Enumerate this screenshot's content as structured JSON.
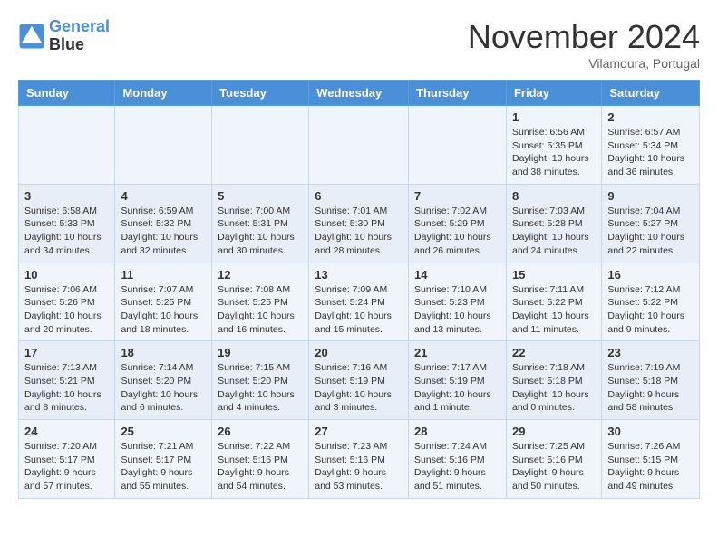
{
  "logo": {
    "line1": "General",
    "line2": "Blue"
  },
  "title": "November 2024",
  "location": "Vilamoura, Portugal",
  "days_of_week": [
    "Sunday",
    "Monday",
    "Tuesday",
    "Wednesday",
    "Thursday",
    "Friday",
    "Saturday"
  ],
  "weeks": [
    [
      {
        "day": "",
        "info": ""
      },
      {
        "day": "",
        "info": ""
      },
      {
        "day": "",
        "info": ""
      },
      {
        "day": "",
        "info": ""
      },
      {
        "day": "",
        "info": ""
      },
      {
        "day": "1",
        "info": "Sunrise: 6:56 AM\nSunset: 5:35 PM\nDaylight: 10 hours and 38 minutes."
      },
      {
        "day": "2",
        "info": "Sunrise: 6:57 AM\nSunset: 5:34 PM\nDaylight: 10 hours and 36 minutes."
      }
    ],
    [
      {
        "day": "3",
        "info": "Sunrise: 6:58 AM\nSunset: 5:33 PM\nDaylight: 10 hours and 34 minutes."
      },
      {
        "day": "4",
        "info": "Sunrise: 6:59 AM\nSunset: 5:32 PM\nDaylight: 10 hours and 32 minutes."
      },
      {
        "day": "5",
        "info": "Sunrise: 7:00 AM\nSunset: 5:31 PM\nDaylight: 10 hours and 30 minutes."
      },
      {
        "day": "6",
        "info": "Sunrise: 7:01 AM\nSunset: 5:30 PM\nDaylight: 10 hours and 28 minutes."
      },
      {
        "day": "7",
        "info": "Sunrise: 7:02 AM\nSunset: 5:29 PM\nDaylight: 10 hours and 26 minutes."
      },
      {
        "day": "8",
        "info": "Sunrise: 7:03 AM\nSunset: 5:28 PM\nDaylight: 10 hours and 24 minutes."
      },
      {
        "day": "9",
        "info": "Sunrise: 7:04 AM\nSunset: 5:27 PM\nDaylight: 10 hours and 22 minutes."
      }
    ],
    [
      {
        "day": "10",
        "info": "Sunrise: 7:06 AM\nSunset: 5:26 PM\nDaylight: 10 hours and 20 minutes."
      },
      {
        "day": "11",
        "info": "Sunrise: 7:07 AM\nSunset: 5:25 PM\nDaylight: 10 hours and 18 minutes."
      },
      {
        "day": "12",
        "info": "Sunrise: 7:08 AM\nSunset: 5:25 PM\nDaylight: 10 hours and 16 minutes."
      },
      {
        "day": "13",
        "info": "Sunrise: 7:09 AM\nSunset: 5:24 PM\nDaylight: 10 hours and 15 minutes."
      },
      {
        "day": "14",
        "info": "Sunrise: 7:10 AM\nSunset: 5:23 PM\nDaylight: 10 hours and 13 minutes."
      },
      {
        "day": "15",
        "info": "Sunrise: 7:11 AM\nSunset: 5:22 PM\nDaylight: 10 hours and 11 minutes."
      },
      {
        "day": "16",
        "info": "Sunrise: 7:12 AM\nSunset: 5:22 PM\nDaylight: 10 hours and 9 minutes."
      }
    ],
    [
      {
        "day": "17",
        "info": "Sunrise: 7:13 AM\nSunset: 5:21 PM\nDaylight: 10 hours and 8 minutes."
      },
      {
        "day": "18",
        "info": "Sunrise: 7:14 AM\nSunset: 5:20 PM\nDaylight: 10 hours and 6 minutes."
      },
      {
        "day": "19",
        "info": "Sunrise: 7:15 AM\nSunset: 5:20 PM\nDaylight: 10 hours and 4 minutes."
      },
      {
        "day": "20",
        "info": "Sunrise: 7:16 AM\nSunset: 5:19 PM\nDaylight: 10 hours and 3 minutes."
      },
      {
        "day": "21",
        "info": "Sunrise: 7:17 AM\nSunset: 5:19 PM\nDaylight: 10 hours and 1 minute."
      },
      {
        "day": "22",
        "info": "Sunrise: 7:18 AM\nSunset: 5:18 PM\nDaylight: 10 hours and 0 minutes."
      },
      {
        "day": "23",
        "info": "Sunrise: 7:19 AM\nSunset: 5:18 PM\nDaylight: 9 hours and 58 minutes."
      }
    ],
    [
      {
        "day": "24",
        "info": "Sunrise: 7:20 AM\nSunset: 5:17 PM\nDaylight: 9 hours and 57 minutes."
      },
      {
        "day": "25",
        "info": "Sunrise: 7:21 AM\nSunset: 5:17 PM\nDaylight: 9 hours and 55 minutes."
      },
      {
        "day": "26",
        "info": "Sunrise: 7:22 AM\nSunset: 5:16 PM\nDaylight: 9 hours and 54 minutes."
      },
      {
        "day": "27",
        "info": "Sunrise: 7:23 AM\nSunset: 5:16 PM\nDaylight: 9 hours and 53 minutes."
      },
      {
        "day": "28",
        "info": "Sunrise: 7:24 AM\nSunset: 5:16 PM\nDaylight: 9 hours and 51 minutes."
      },
      {
        "day": "29",
        "info": "Sunrise: 7:25 AM\nSunset: 5:16 PM\nDaylight: 9 hours and 50 minutes."
      },
      {
        "day": "30",
        "info": "Sunrise: 7:26 AM\nSunset: 5:15 PM\nDaylight: 9 hours and 49 minutes."
      }
    ]
  ]
}
